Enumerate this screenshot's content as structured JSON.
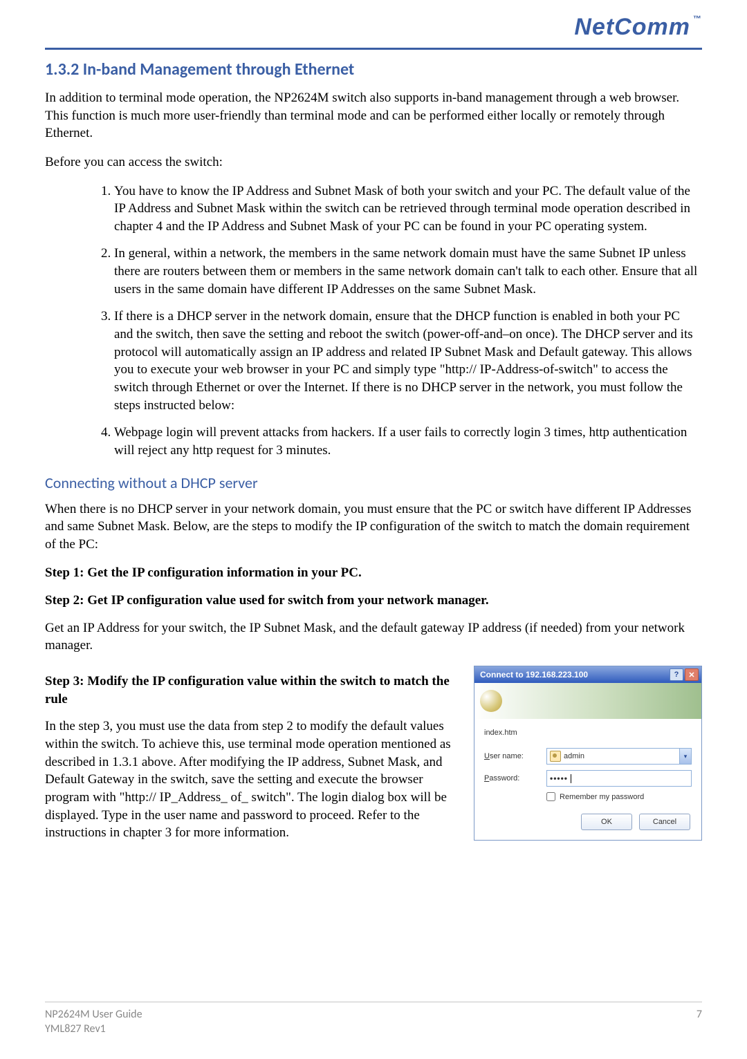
{
  "brand": {
    "name": "NetComm",
    "tm": "™"
  },
  "section": {
    "heading": "1.3.2 In-band Management through Ethernet",
    "intro": "In addition to terminal mode operation, the NP2624M switch also supports in-band management through a web browser.  This function is much more user-friendly than terminal mode and can be performed either locally or remotely through Ethernet.",
    "before": "Before you can access the switch:",
    "items": [
      "You have to know the IP Address and Subnet Mask of both your switch and your PC. The default value of the IP Address and Subnet Mask within the switch can be retrieved through terminal mode operation described in chapter 4 and  the IP Address and Subnet Mask of your PC can be found in your PC operating system.",
      "In general, within a network, the members in the same network domain must have the same Subnet IP unless there are routers between them or members in the same network domain can't talk to each other.  Ensure that all users in the same domain have different IP Addresses on the same Subnet Mask.",
      "If there is a DHCP server in the network domain, ensure that the DHCP function is enabled in both your PC and the switch, then save the setting and reboot the switch (power-off-and–on once).  The DHCP server and its protocol will automatically assign an IP address and related IP Subnet Mask and Default gateway.  This allows you to execute your web browser in your PC and simply type \"http:// IP-Address-of-switch\" to access the switch through Ethernet or over the Internet.  If there is no DHCP server in the network, you must follow the steps instructed below:",
      "Webpage login will prevent attacks from hackers. If a user fails to correctly login 3 times, http authentication will reject any http request for 3 minutes."
    ]
  },
  "dhcp": {
    "heading": "Connecting without a DHCP server",
    "intro": "When there is no DHCP server in your network domain, you must ensure that the PC or switch have different IP Addresses and same Subnet Mask. Below, are the steps to modify the IP configuration of the switch to match the domain requirement of the PC:",
    "step1": "Step 1: Get the IP configuration information in your PC.",
    "step2": "Step 2: Get IP configuration value used for switch from your network manager.",
    "step2_body": "Get an IP Address for your switch, the IP Subnet Mask, and the default gateway IP address (if needed) from your network manager.",
    "step3": "Step 3: Modify the IP configuration value within the switch to match the rule",
    "step3_body": "In the step 3, you must use the data from step 2 to modify the default values within the switch.  To achieve this, use terminal mode operation mentioned as described in 1.3.1 above. After modifying the IP address, Subnet Mask, and Default Gateway in the switch, save the setting and execute the browser program with \"http:// IP_Address_ of_ switch\". The login dialog box will be displayed. Type in the user name and password to proceed. Refer to the instructions in chapter 3 for more information."
  },
  "dialog": {
    "title": "Connect to 192.168.223.100",
    "page": "index.htm",
    "username_label_prefix": "U",
    "username_label_rest": "ser name:",
    "password_label_prefix": "P",
    "password_label_rest": "assword:",
    "username_value": "admin",
    "password_value": "•••••",
    "remember_prefix": "R",
    "remember_rest": "emember my password",
    "ok": "OK",
    "cancel": "Cancel"
  },
  "footer": {
    "guide": "NP2624M User Guide",
    "rev": "YML827 Rev1",
    "page": "7"
  }
}
